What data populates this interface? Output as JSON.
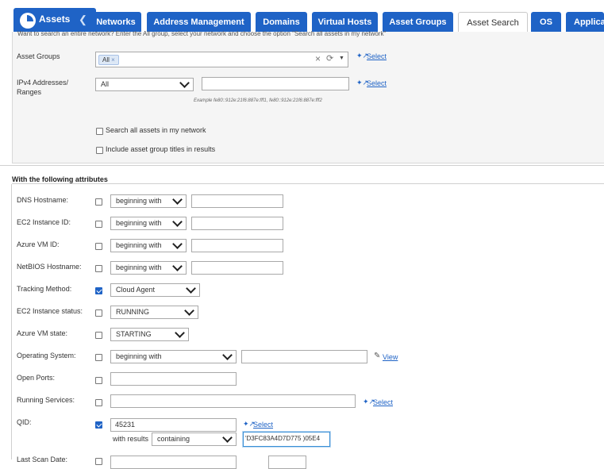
{
  "nav": {
    "brand": "Assets",
    "tabs": [
      "Networks",
      "Address Management",
      "Domains",
      "Virtual Hosts",
      "Asset Groups",
      "Asset Search",
      "OS",
      "Applica"
    ]
  },
  "search": {
    "hint": "Want to search an entire network? Enter the All group, select your network and choose the option \"Search all assets in my network\"",
    "asset_groups_label": "Asset Groups",
    "asset_groups_token": "All",
    "ipv4_label_1": "IPv4 Addresses/",
    "ipv4_label_2": "Ranges",
    "ipv4_select_value": "All",
    "ipv4_example": "Example fe80::912e:21f6:887e:fff1, fe80::912e:21f6:887e:fff2",
    "select_link": "Select",
    "search_all_label": "Search all assets in my network",
    "include_titles_label": "Include asset group titles in results"
  },
  "attributes": {
    "section_title": "With the following attributes",
    "dns_label": "DNS Hostname:",
    "ec2_label": "EC2 Instance ID:",
    "azure_id_label": "Azure VM ID:",
    "netbios_label": "NetBIOS Hostname:",
    "match_option": "beginning with",
    "tracking_label": "Tracking Method:",
    "tracking_value": "Cloud Agent",
    "ec2_status_label": "EC2 Instance status:",
    "ec2_status_value": "RUNNING",
    "azure_state_label": "Azure VM state:",
    "azure_state_value": "STARTING",
    "os_label": "Operating System:",
    "view_link": "View",
    "ports_label": "Open Ports:",
    "services_label": "Running Services:",
    "qid_label": "QID:",
    "qid_value": "45231",
    "with_results_label": "with results",
    "results_match": "containing",
    "results_value": "'D3FC83A4D7D775 )05E4",
    "last_scan_label": "Last Scan Date:"
  },
  "colors": {
    "accent": "#1f63c6",
    "panel_bg": "#f5f5f5"
  }
}
